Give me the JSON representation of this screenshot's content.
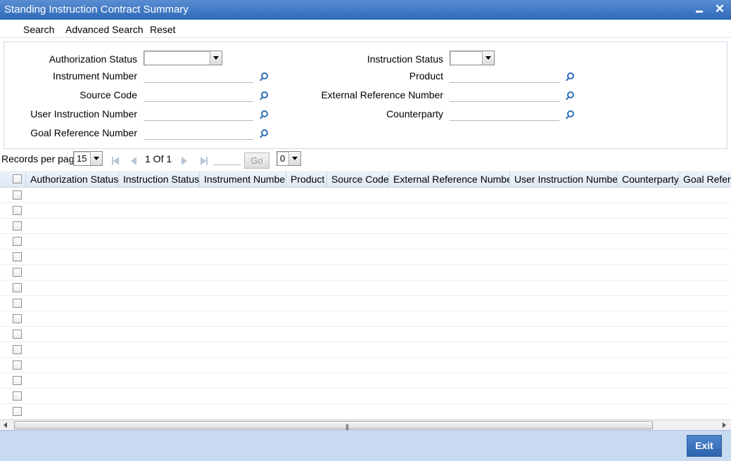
{
  "window": {
    "title": "Standing Instruction Contract Summary"
  },
  "menu": {
    "search": "Search",
    "advanced_search": "Advanced Search",
    "reset": "Reset"
  },
  "search": {
    "authorization_status_label": "Authorization Status",
    "instrument_number_label": "Instrument Number",
    "source_code_label": "Source Code",
    "user_instruction_number_label": "User Instruction Number",
    "goal_reference_number_label": "Goal Reference Number",
    "instruction_status_label": "Instruction Status",
    "product_label": "Product",
    "external_reference_number_label": "External Reference Number",
    "counterparty_label": "Counterparty",
    "authorization_status_value": "",
    "instruction_status_value": ""
  },
  "pager": {
    "records_per_page_label": "Records per page",
    "records_per_page_value": "15",
    "page_info": "1 Of 1",
    "go_label": "Go",
    "goto_value": "0"
  },
  "grid": {
    "columns": [
      "Authorization Status",
      "Instruction Status",
      "Instrument Number",
      "Product",
      "Source Code",
      "External Reference Number",
      "User Instruction Number",
      "Counterparty",
      "Goal Refere"
    ],
    "row_count": 15
  },
  "footer": {
    "exit_label": "Exit"
  }
}
